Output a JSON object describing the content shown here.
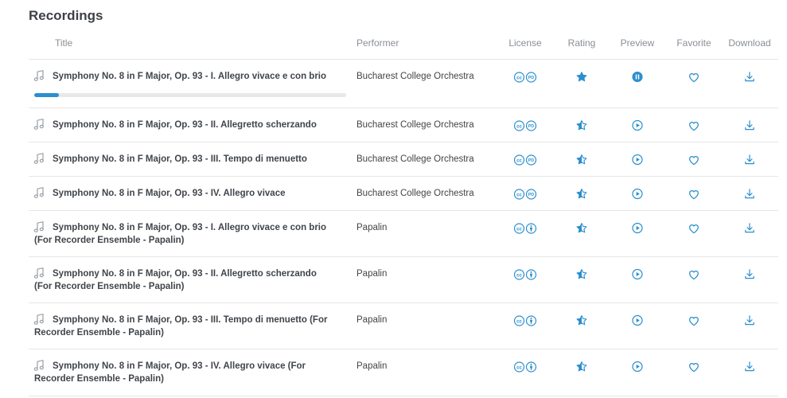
{
  "page": {
    "title": "Recordings"
  },
  "columns": {
    "title": "Title",
    "performer": "Performer",
    "license": "License",
    "rating": "Rating",
    "preview": "Preview",
    "favorite": "Favorite",
    "download": "Download"
  },
  "colors": {
    "accent": "#2b8fce",
    "text": "#40454b",
    "muted": "#8a8f96"
  },
  "rows": [
    {
      "title": "Symphony No. 8 in F Major, Op. 93 - I. Allegro vivace e con brio",
      "performer": "Bucharest College Orchestra",
      "license_icons": [
        "cc-icon",
        "public-domain-icon"
      ],
      "rating_icon": "star-full-icon",
      "preview_state": "pause-icon",
      "playing": true,
      "progress": 0.08
    },
    {
      "title": "Symphony No. 8 in F Major, Op. 93 - II. Allegretto scherzando",
      "performer": "Bucharest College Orchestra",
      "license_icons": [
        "cc-icon",
        "public-domain-icon"
      ],
      "rating_icon": "star-half-icon",
      "preview_state": "play-icon"
    },
    {
      "title": "Symphony No. 8 in F Major, Op. 93 - III. Tempo di menuetto",
      "performer": "Bucharest College Orchestra",
      "license_icons": [
        "cc-icon",
        "public-domain-icon"
      ],
      "rating_icon": "star-half-icon",
      "preview_state": "play-icon"
    },
    {
      "title": "Symphony No. 8 in F Major, Op. 93 - IV. Allegro vivace",
      "performer": "Bucharest College Orchestra",
      "license_icons": [
        "cc-icon",
        "public-domain-icon"
      ],
      "rating_icon": "star-half-icon",
      "preview_state": "play-icon"
    },
    {
      "title": "Symphony No. 8 in F Major, Op. 93 - I. Allegro vivace e con brio (For Recorder Ensemble - Papalin)",
      "performer": "Papalin",
      "license_icons": [
        "cc-icon",
        "attribution-icon"
      ],
      "rating_icon": "star-half-icon",
      "preview_state": "play-icon"
    },
    {
      "title": "Symphony No. 8 in F Major, Op. 93 - II. Allegretto scherzando (For Recorder Ensemble - Papalin)",
      "performer": "Papalin",
      "license_icons": [
        "cc-icon",
        "attribution-icon"
      ],
      "rating_icon": "star-half-icon",
      "preview_state": "play-icon"
    },
    {
      "title": "Symphony No. 8 in F Major, Op. 93 - III. Tempo di menuetto (For Recorder Ensemble - Papalin)",
      "performer": "Papalin",
      "license_icons": [
        "cc-icon",
        "attribution-icon"
      ],
      "rating_icon": "star-half-icon",
      "preview_state": "play-icon"
    },
    {
      "title": "Symphony No. 8 in F Major, Op. 93 - IV. Allegro vivace (For Recorder Ensemble - Papalin)",
      "performer": "Papalin",
      "license_icons": [
        "cc-icon",
        "attribution-icon"
      ],
      "rating_icon": "star-half-icon",
      "preview_state": "play-icon"
    }
  ]
}
